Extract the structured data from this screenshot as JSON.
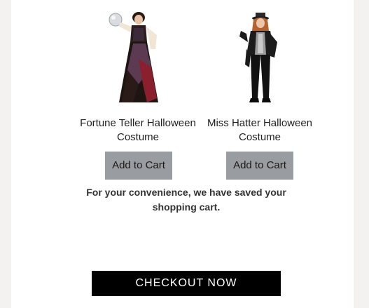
{
  "products": [
    {
      "name": "Fortune Teller Halloween Costume",
      "button_label": "Add to Cart",
      "image": "fortune-teller-costume-photo",
      "button_color": "#999ca0"
    },
    {
      "name": "Miss Hatter Halloween Costume",
      "button_label": "Add to Cart",
      "image": "miss-hatter-costume-photo",
      "button_color": "#999ca0"
    }
  ],
  "notice": "For your convenience, we have saved your shopping cart.",
  "checkout": {
    "label": "CHECKOUT NOW",
    "background": "#000000",
    "text_color": "#ffffff"
  },
  "colors": {
    "page_background": "#f3f2f1",
    "panel_background": "#ffffff"
  }
}
